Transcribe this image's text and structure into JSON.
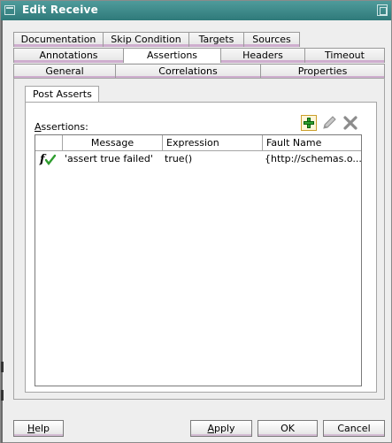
{
  "window": {
    "title": "Edit Receive"
  },
  "tabs": {
    "row1": [
      "Documentation",
      "Skip Condition",
      "Targets",
      "Sources"
    ],
    "row2": [
      "Annotations",
      "Assertions",
      "Headers",
      "Timeout"
    ],
    "row3": [
      "General",
      "Correlations",
      "Properties"
    ],
    "selected": "Assertions"
  },
  "subtab": {
    "label": "Post Asserts"
  },
  "assertions": {
    "label_mnemonic": "A",
    "label_rest": "ssertions:",
    "toolbar": {
      "add": "plus-icon",
      "edit": "pencil-icon",
      "delete": "x-icon"
    },
    "columns": [
      "",
      "Message",
      "Expression",
      "Fault Name"
    ],
    "rows": [
      {
        "icon": "function-check-icon",
        "message": "'assert true failed'",
        "expression": "true()",
        "fault_name": "{http://schemas.o..."
      }
    ]
  },
  "buttons": {
    "help": {
      "mnemonic": "H",
      "rest": "elp"
    },
    "apply": {
      "mnemonic": "A",
      "rest": "pply"
    },
    "ok": "OK",
    "cancel": "Cancel"
  },
  "colors": {
    "title_bar": "#2f7a7a",
    "tab_accent": "#c9a2c9",
    "add_icon": "#2fa02f"
  }
}
